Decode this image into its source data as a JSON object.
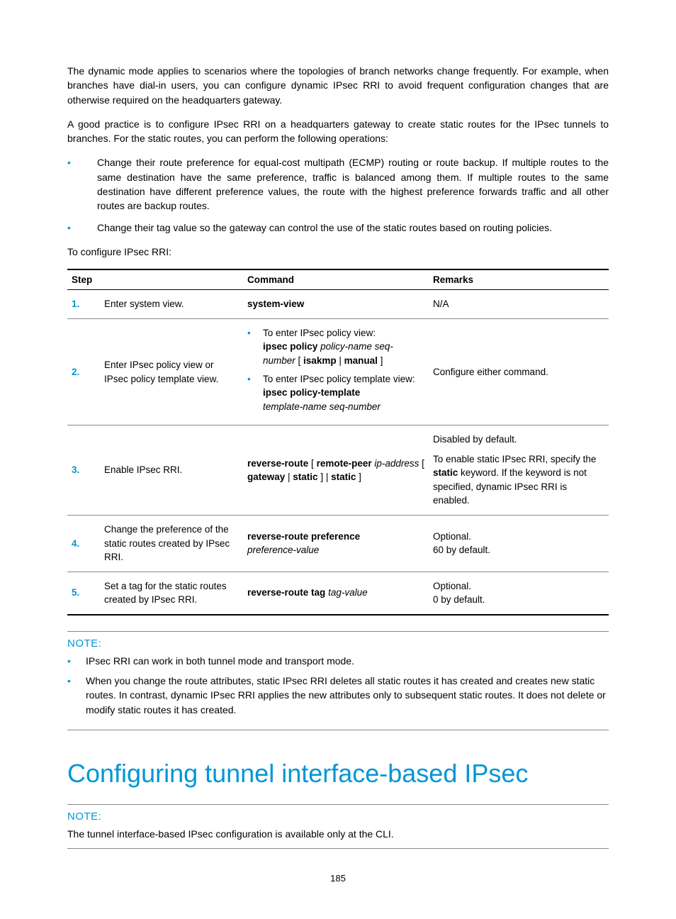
{
  "para1": "The dynamic mode applies to scenarios where the topologies of branch networks change frequently. For example, when branches have dial-in users, you can configure dynamic IPsec RRI to avoid frequent configuration changes that are otherwise required on the headquarters gateway.",
  "para2": "A good practice is to configure IPsec RRI on a headquarters gateway to create static routes for the IPsec tunnels to branches. For the static routes, you can perform the following operations:",
  "bullets": {
    "b1": "Change their route preference for equal-cost multipath (ECMP) routing or route backup. If multiple routes to the same destination have the same preference, traffic is balanced among them. If multiple routes to the same destination have different preference values, the route with the highest preference forwards traffic and all other routes are backup routes.",
    "b2": "Change their tag value so the gateway can control the use of the static routes based on routing policies."
  },
  "lead_in": "To configure IPsec RRI:",
  "table": {
    "headers": {
      "step": "Step",
      "command": "Command",
      "remarks": "Remarks"
    },
    "r1": {
      "num": "1.",
      "step": "Enter system view.",
      "cmd_b": "system-view",
      "remarks": "N/A"
    },
    "r2": {
      "num": "2.",
      "step": "Enter IPsec policy view or IPsec policy template view.",
      "cmd1_text": "To enter IPsec policy view:",
      "cmd1_b1": "ipsec policy",
      "cmd1_i1": "policy-name seq-number",
      "cmd1_lb": " [ ",
      "cmd1_b2": "isakmp",
      "cmd1_pipe": " | ",
      "cmd1_b3": "manual",
      "cmd1_rb": " ]",
      "cmd2_text": "To enter IPsec policy template view:",
      "cmd2_b": "ipsec policy-template",
      "cmd2_i": "template-name seq-number",
      "remarks": "Configure either command."
    },
    "r3": {
      "num": "3.",
      "step": "Enable IPsec RRI.",
      "cmd_b1": "reverse-route",
      "cmd_lb1": " [ ",
      "cmd_b2": "remote-peer",
      "cmd_i1": "ip-address",
      "cmd_lb2": " [ ",
      "cmd_b3": "gateway",
      "cmd_pipe": " | ",
      "cmd_b4": "static",
      "cmd_rb1": " ] | ",
      "cmd_b5": "static",
      "cmd_rb2": " ]",
      "remarks1": "Disabled by default.",
      "remarks2_a": "To enable static IPsec RRI, specify the ",
      "remarks2_b": "static",
      "remarks2_c": " keyword. If the keyword is not specified, dynamic IPsec RRI is enabled."
    },
    "r4": {
      "num": "4.",
      "step": "Change the preference of the static routes created by IPsec RRI.",
      "cmd_b": "reverse-route preference",
      "cmd_i": "preference-value",
      "remarks1": "Optional.",
      "remarks2": "60 by default."
    },
    "r5": {
      "num": "5.",
      "step": "Set a tag for the static routes created by IPsec RRI.",
      "cmd_b": "reverse-route tag",
      "cmd_i": "tag-value",
      "remarks1": "Optional.",
      "remarks2": "0 by default."
    }
  },
  "note1": {
    "label": "NOTE:",
    "b1": "IPsec RRI can work in both tunnel mode and transport mode.",
    "b2": "When you change the route attributes, static IPsec RRI deletes all static routes it has created and creates new static routes. In contrast, dynamic IPsec RRI applies the new attributes only to subsequent static routes. It does not delete or modify static routes it has created."
  },
  "heading": "Configuring tunnel interface-based IPsec",
  "note2": {
    "label": "NOTE:",
    "text": "The tunnel interface-based IPsec configuration is available only at the CLI."
  },
  "pagenum": "185"
}
